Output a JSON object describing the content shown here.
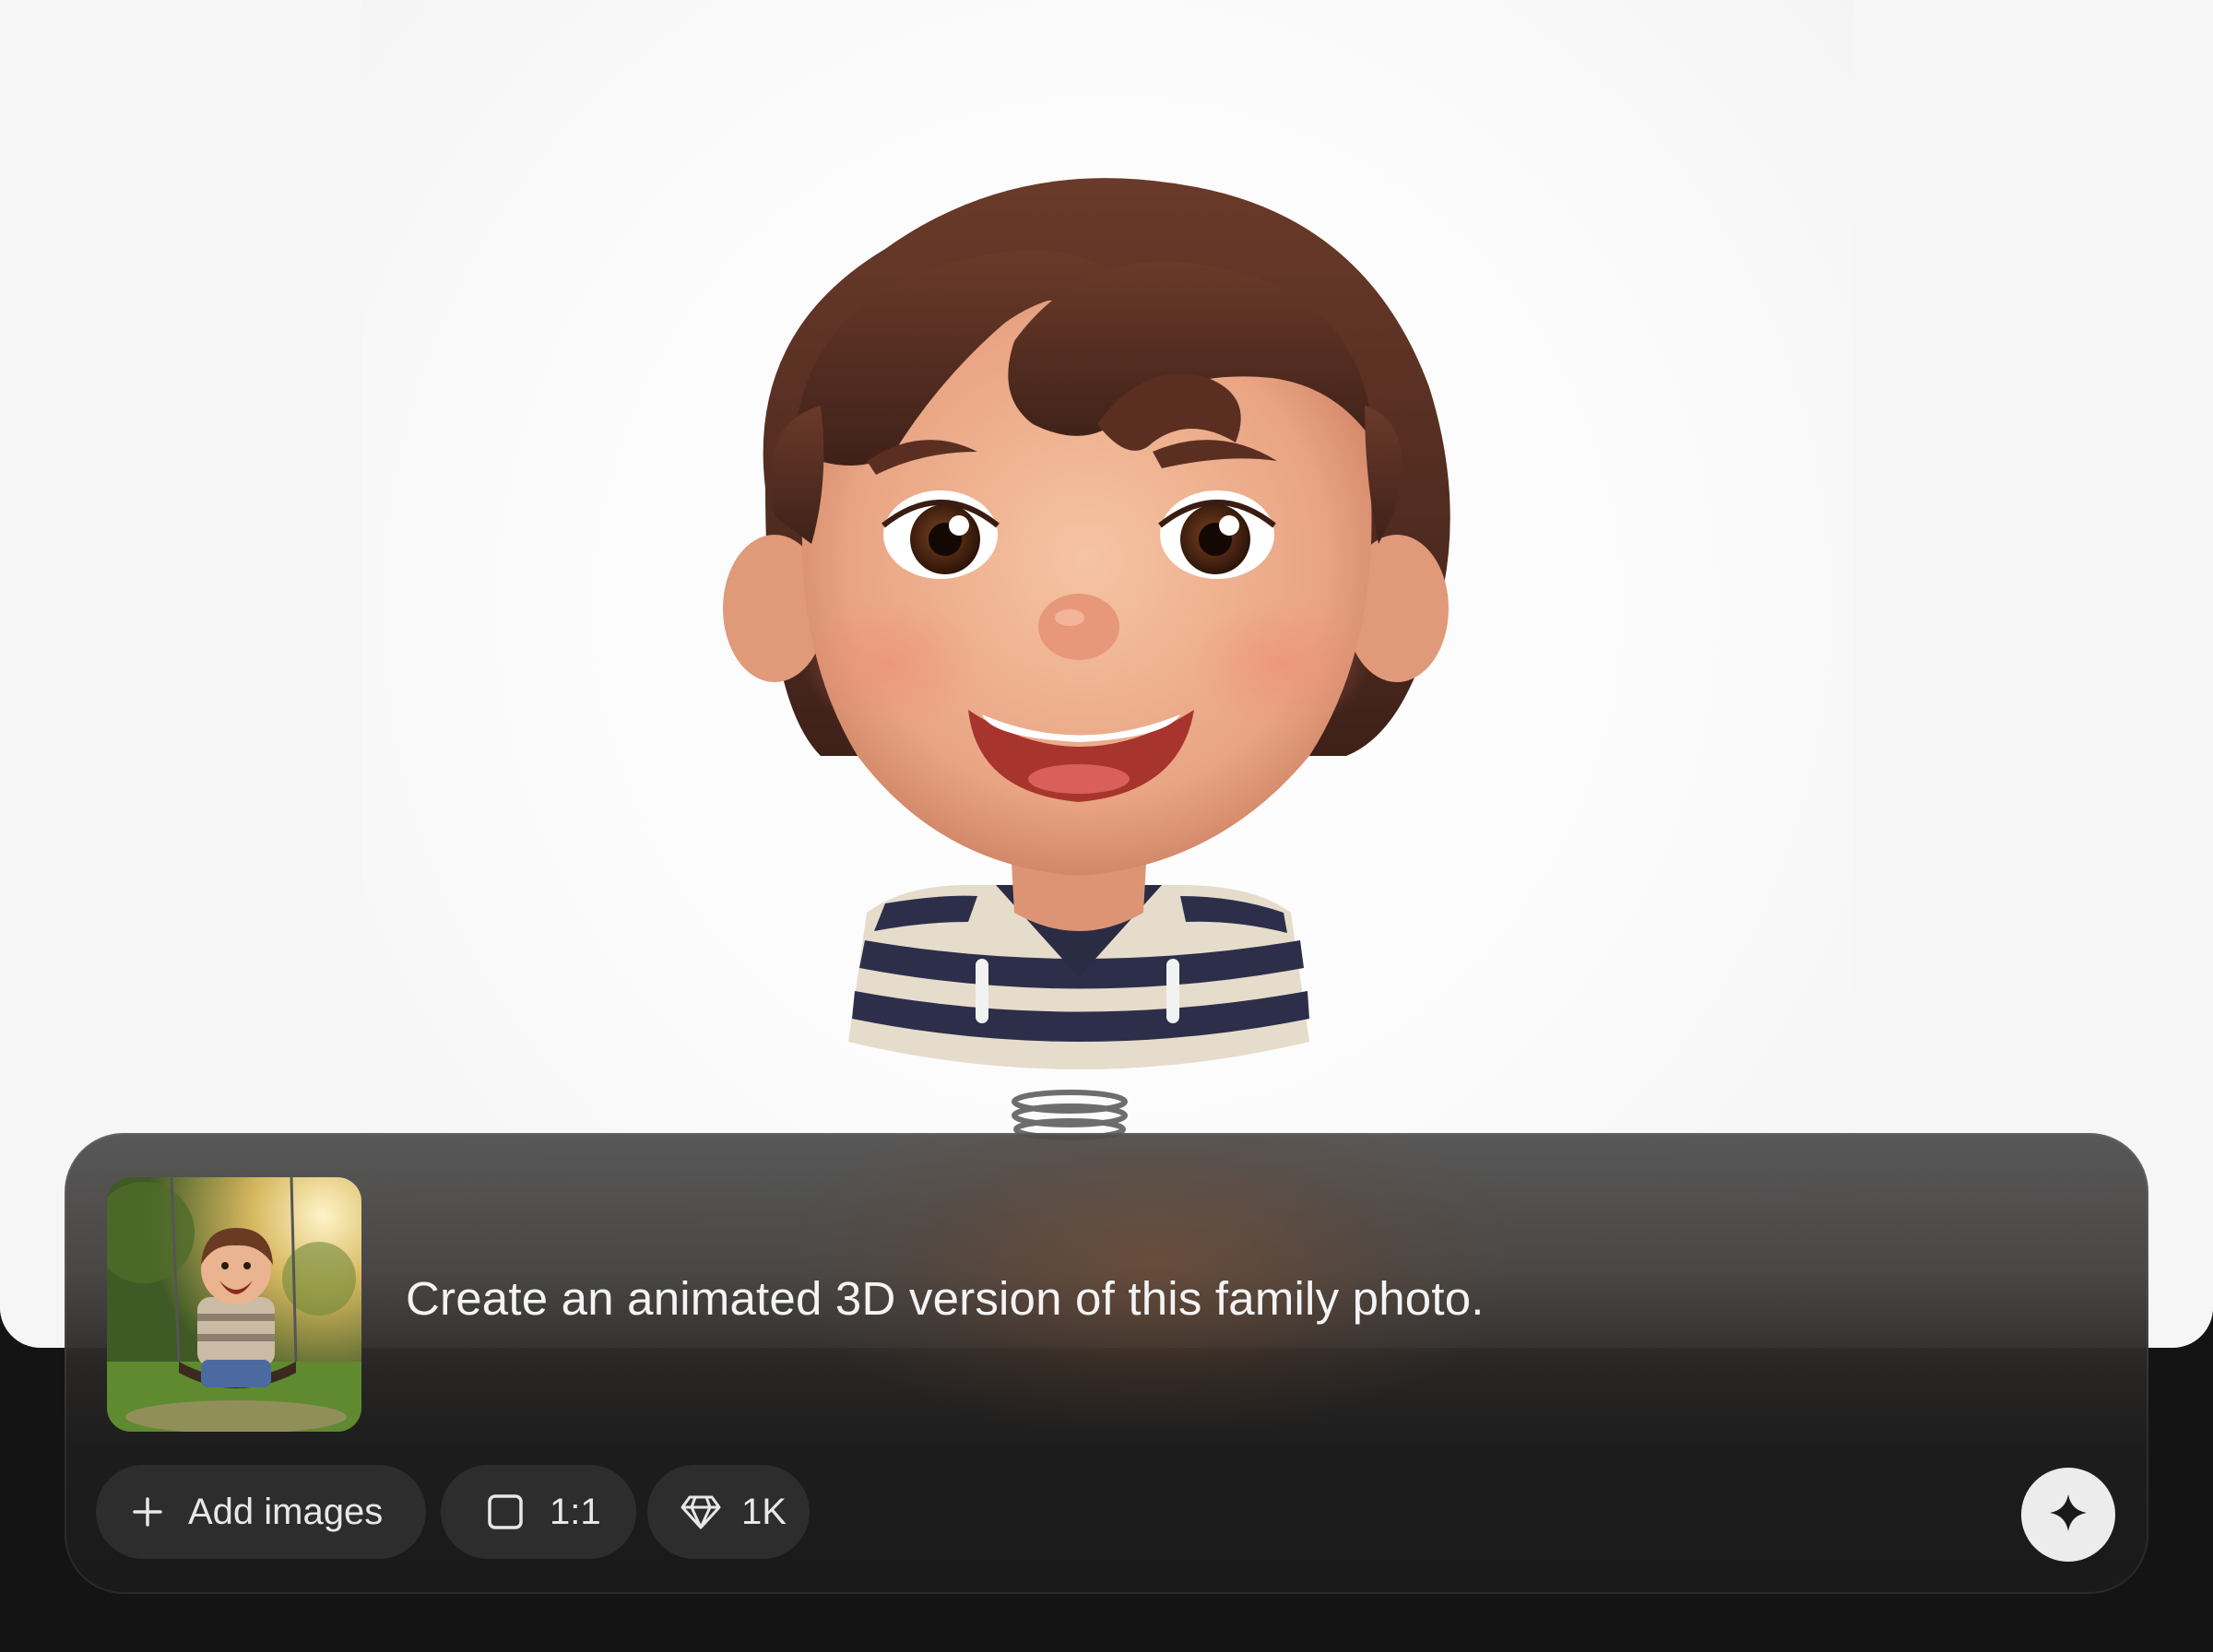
{
  "canvas": {
    "background": "#f7f7f7",
    "image_subject": "3d-cartoon-child-avatar"
  },
  "prompt": {
    "text": "Create an animated 3D version of this family photo.",
    "reference_thumbnail": "child-on-swing-photo"
  },
  "toolbar": {
    "add_images_icon": "plus-icon",
    "add_images_label": "Add images",
    "aspect_ratio_icon": "square-icon",
    "aspect_ratio_label": "1:1",
    "resolution_icon": "diamond-icon",
    "resolution_label": "1K",
    "generate_icon": "sparkle-icon"
  },
  "colors": {
    "panel": "#2a2a2a",
    "chip": "#2d2d2d",
    "text": "#f4f4f4",
    "generate_button": "#ececec"
  }
}
